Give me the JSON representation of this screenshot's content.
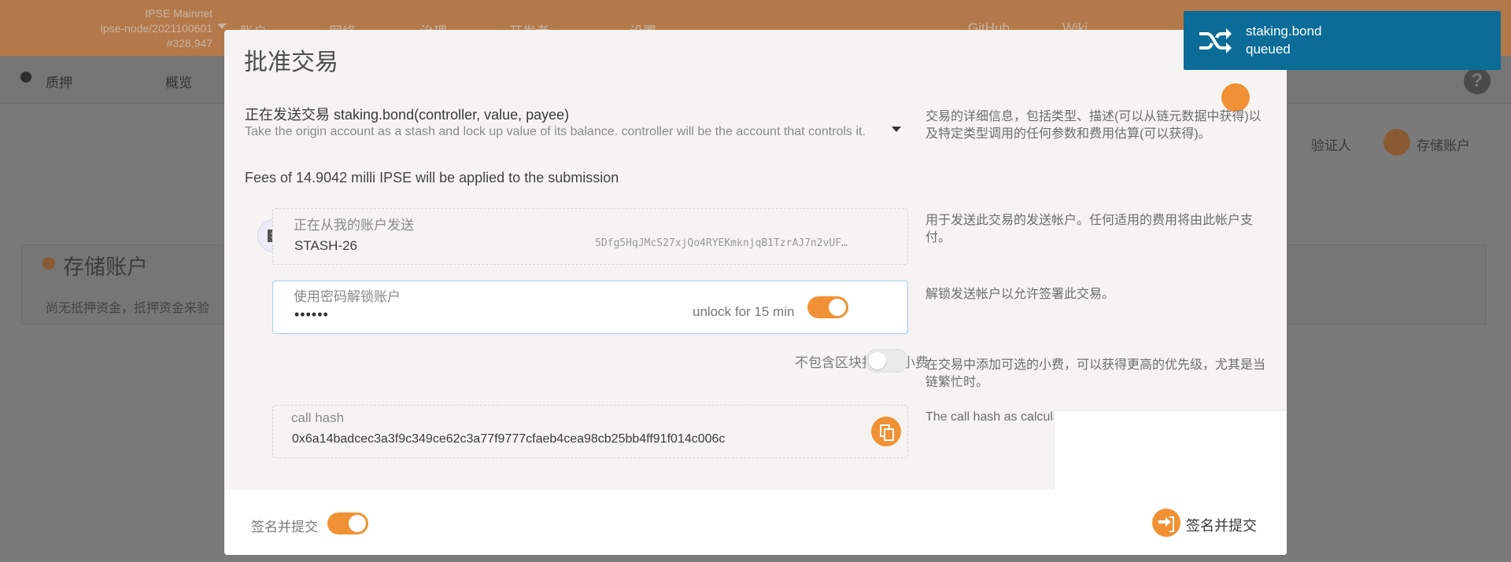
{
  "header": {
    "chain_name": "IPSE Mainnet",
    "node_version": "ipse-node/2021100601",
    "block_number": "#328,947",
    "menu": [
      "账户",
      "网络",
      "治理",
      "开发者",
      "设置",
      "GitHub",
      "Wiki"
    ]
  },
  "subnav": {
    "section": "质押",
    "tabs": [
      "概览"
    ]
  },
  "background": {
    "card_title": "存储账户",
    "card_text": "尚无抵押资金，抵押资金来验",
    "btn_validator": "验证人",
    "btn_stash": "存储账户"
  },
  "modal": {
    "title": "批准交易",
    "tx_call": "正在发送交易 staking.bond(controller, value, payee)",
    "tx_desc": "Take the origin account as a stash and lock up value of its balance. controller will be the account that controls it.",
    "tx_help": "交易的详细信息，包括类型、描述(可以从链元数据中获得)以及特定类型调用的任何参数和费用估算(可以获得)。",
    "fees": "Fees of 14.9042 milli IPSE will be applied to the submission",
    "sender": {
      "label": "正在从我的账户发送",
      "name": "STASH-26",
      "address": "5Dfg5HqJMcS27xjQo4RYEKmknjqB1TzrAJ7n2vUF…",
      "help": "用于发送此交易的发送帐户。任何适用的费用将由此帐户支付。"
    },
    "password": {
      "label": "使用密码解锁账户",
      "value": "••••••",
      "unlock_text": "unlock for 15 min",
      "unlock_enabled": true,
      "help": "解锁发送帐户以允许签署此交易。"
    },
    "tip": {
      "label": "不包含区块打包者小费",
      "enabled": false,
      "help": "在交易中添加可选的小费，可以获得更高的优先级，尤其是当链繁忙时。"
    },
    "call_hash": {
      "label": "call hash",
      "value": "0x6a14badcec3a3f9c349ce62c3a77f9777cfaeb4cea98cb25bb4ff91f014c006c",
      "help": "The call hash as calculated for this transaction"
    },
    "footer": {
      "sign_label": "签名并提交",
      "sign_enabled": true,
      "submit_label": "签名并提交"
    }
  },
  "toast": {
    "title": "staking.bond",
    "status": "queued"
  },
  "colors": {
    "accent": "#f19135",
    "toast_bg": "#0b6c98",
    "header_bg": "#b3794a"
  }
}
